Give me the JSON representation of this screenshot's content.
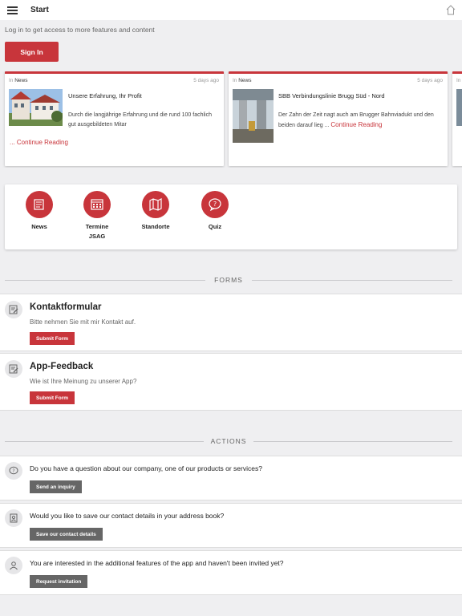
{
  "header": {
    "title": "Start",
    "menu_icon": "hamburger-menu-icon",
    "home_icon": "home-icon"
  },
  "login": {
    "note": "Log in to get access to more features and content",
    "signin_label": "Sign In"
  },
  "news": [
    {
      "in_prefix": "In",
      "category": "News",
      "age": "5 days ago",
      "title": "Unsere Erfahrung, Ihr Profit",
      "excerpt": "Durch die langjährige Erfahrung und die rund 100 fachlich gut ausgebildeten Mitar",
      "read_more": "... Continue Reading"
    },
    {
      "in_prefix": "In",
      "category": "News",
      "age": "5 days ago",
      "title": "SBB Verbindungslinie Brugg Süd -  Nord",
      "excerpt": "Der Zahn der Zeit nagt auch am Brugger Bahnviadukt und den beiden darauf lieg ...",
      "read_more": "Continue Reading"
    },
    {
      "in_prefix": "In"
    }
  ],
  "quick_links": [
    {
      "label": "News",
      "icon": "newspaper-icon"
    },
    {
      "label": "Termine JSAG",
      "icon": "calendar-icon"
    },
    {
      "label": "Standorte",
      "icon": "map-icon"
    },
    {
      "label": "Quiz",
      "icon": "question-bubble-icon"
    }
  ],
  "forms": {
    "heading": "FORMS",
    "items": [
      {
        "title": "Kontaktformular",
        "description": "Bitte nehmen Sie mit mir Kontakt auf.",
        "button": "Submit Form",
        "icon": "form-edit-icon"
      },
      {
        "title": "App-Feedback",
        "description": "Wie ist Ihre Meinung zu unserer App?",
        "button": "Submit Form",
        "icon": "form-edit-icon"
      }
    ]
  },
  "actions": {
    "heading": "ACTIONS",
    "items": [
      {
        "question": "Do you have a question about our company, one of our products or services?",
        "button": "Send an inquiry",
        "icon": "question-chat-icon"
      },
      {
        "question": "Would you like to save our contact details in your address book?",
        "button": "Save our contact details",
        "icon": "contact-card-icon"
      },
      {
        "question": "You are interested in the additional features of the app and haven't been invited yet?",
        "button": "Request invitation",
        "icon": "user-icon"
      }
    ]
  },
  "colors": {
    "accent": "#c8353b",
    "background": "#efeff1",
    "action_button": "#666666"
  }
}
